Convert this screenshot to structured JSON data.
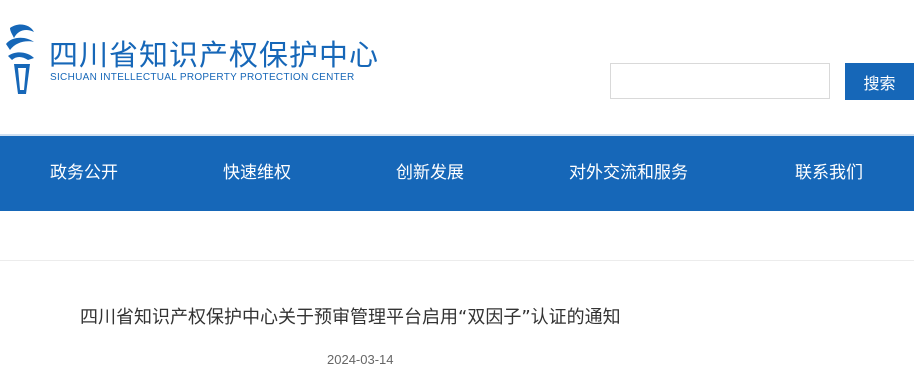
{
  "header": {
    "title": "四川省知识产权保护中心",
    "subtitle": "SICHUAN INTELLECTUAL PROPERTY PROTECTION CENTER",
    "logo_icon": "flame-torch-logo-icon",
    "brand_color": "#1667b8"
  },
  "search": {
    "placeholder": "",
    "value": "",
    "button_label": "搜索"
  },
  "nav": {
    "items": [
      {
        "label": "政务公开"
      },
      {
        "label": "快速维权"
      },
      {
        "label": "创新发展"
      },
      {
        "label": "对外交流和服务"
      },
      {
        "label": "联系我们"
      }
    ]
  },
  "article": {
    "title": "四川省知识产权保护中心关于预审管理平台启用“双因子”认证的通知",
    "date": "2024-03-14"
  }
}
